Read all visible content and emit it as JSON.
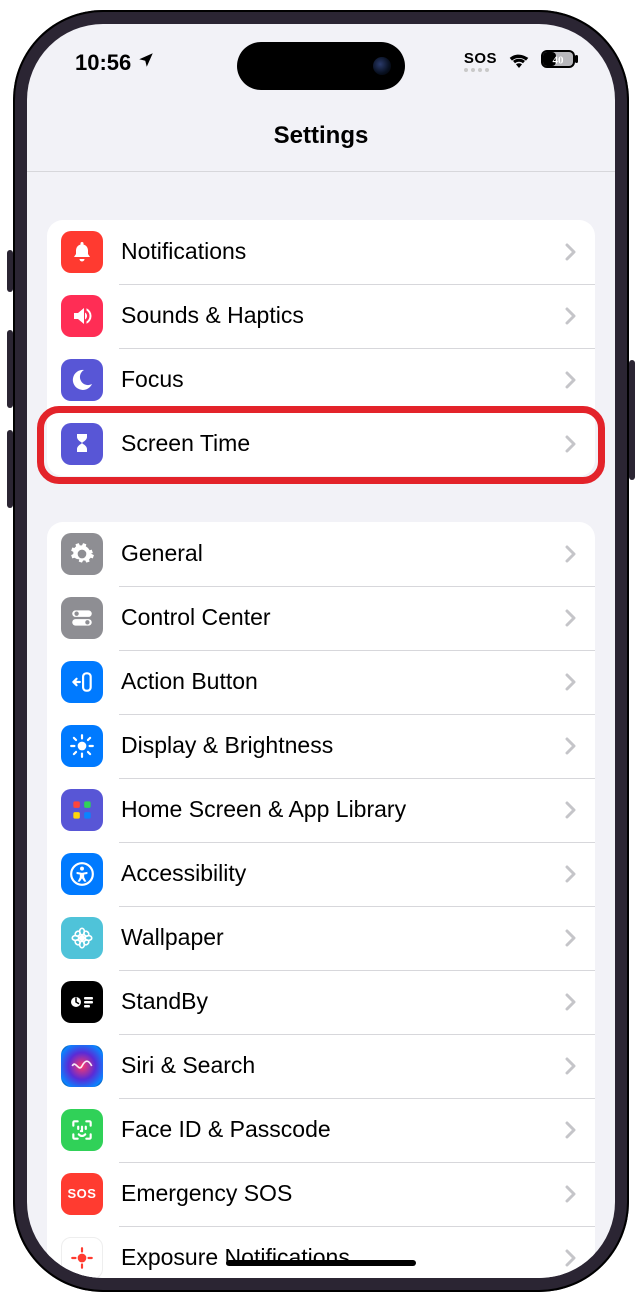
{
  "status": {
    "time": "10:56",
    "sos": "SOS",
    "battery_pct": "40"
  },
  "nav": {
    "title": "Settings"
  },
  "group1": {
    "items": [
      {
        "label": "Notifications"
      },
      {
        "label": "Sounds & Haptics"
      },
      {
        "label": "Focus"
      },
      {
        "label": "Screen Time"
      }
    ]
  },
  "group2": {
    "items": [
      {
        "label": "General"
      },
      {
        "label": "Control Center"
      },
      {
        "label": "Action Button"
      },
      {
        "label": "Display & Brightness"
      },
      {
        "label": "Home Screen & App Library"
      },
      {
        "label": "Accessibility"
      },
      {
        "label": "Wallpaper"
      },
      {
        "label": "StandBy"
      },
      {
        "label": "Siri & Search"
      },
      {
        "label": "Face ID & Passcode"
      },
      {
        "label": "Emergency SOS"
      },
      {
        "label": "Exposure Notifications"
      }
    ],
    "sos_text": "SOS"
  },
  "highlight": {
    "target": "screen-time"
  }
}
